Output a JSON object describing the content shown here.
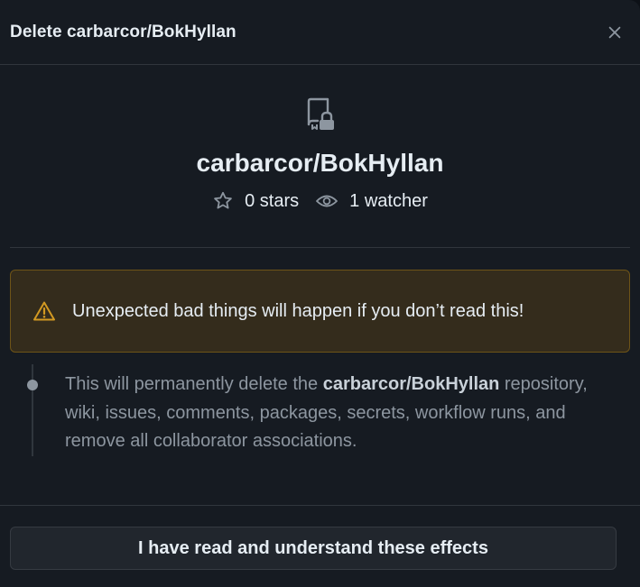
{
  "dialog": {
    "title": "Delete carbarcor/BokHyllan",
    "close_icon": "x-icon"
  },
  "repo": {
    "icon": "repo-locked-icon",
    "full_name": "carbarcor/BokHyllan",
    "stars_label": "0 stars",
    "watchers_label": "1 watcher"
  },
  "warning": {
    "icon": "alert-triangle-icon",
    "text": "Unexpected bad things will happen if you don’t read this!",
    "color": "#d29922"
  },
  "effects": {
    "prefix": "This will permanently delete the ",
    "repo_name": "carbarcor/BokHyllan",
    "suffix": " repository, wiki, issues, comments, packages, secrets, workflow runs, and remove all collaborator associations."
  },
  "footer": {
    "confirm_label": "I have read and understand these effects"
  }
}
